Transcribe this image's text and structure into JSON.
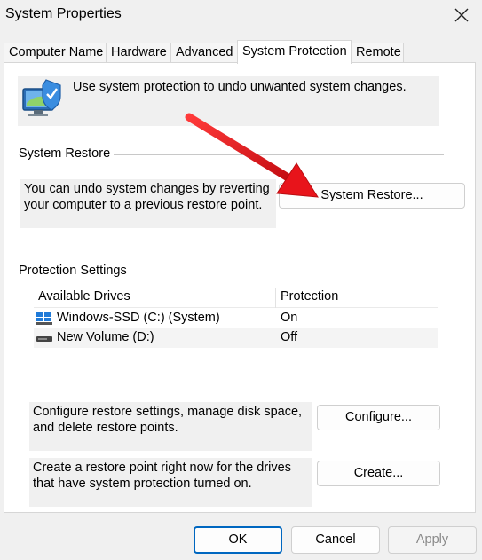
{
  "window": {
    "title": "System Properties"
  },
  "tabs": [
    {
      "label": "Computer Name"
    },
    {
      "label": "Hardware"
    },
    {
      "label": "Advanced"
    },
    {
      "label": "System Protection",
      "active": true
    },
    {
      "label": "Remote"
    }
  ],
  "intro": {
    "text": "Use system protection to undo unwanted system changes.",
    "icon": "system-protection-icon"
  },
  "restore": {
    "group_label": "System Restore",
    "description": "You can undo system changes by reverting your computer to a previous restore point.",
    "button_label": "System Restore..."
  },
  "protection": {
    "group_label": "Protection Settings",
    "columns": [
      "Available Drives",
      "Protection"
    ],
    "drives": [
      {
        "name": "Windows-SSD (C:) (System)",
        "protection": "On",
        "icon": "windows-drive-icon"
      },
      {
        "name": "New Volume (D:)",
        "protection": "Off",
        "icon": "drive-icon"
      }
    ],
    "configure": {
      "description": "Configure restore settings, manage disk space, and delete restore points.",
      "button_label": "Configure..."
    },
    "create": {
      "description": "Create a restore point right now for the drives that have system protection turned on.",
      "button_label": "Create..."
    }
  },
  "footer": {
    "ok_label": "OK",
    "cancel_label": "Cancel",
    "apply_label": "Apply"
  },
  "annotation": {
    "arrow_color": "#e8141b"
  }
}
